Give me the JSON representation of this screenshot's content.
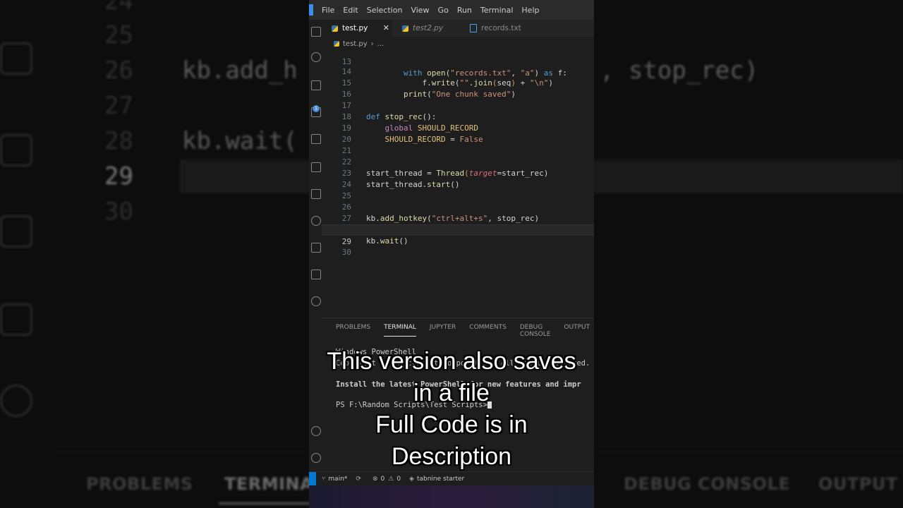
{
  "menu": [
    "File",
    "Edit",
    "Selection",
    "View",
    "Go",
    "Run",
    "Terminal",
    "Help"
  ],
  "tabs": [
    {
      "label": "test.py",
      "active": true,
      "icon": "python-icon"
    },
    {
      "label": "test2.py",
      "active": false,
      "icon": "python-icon"
    },
    {
      "label": "records.txt",
      "active": false,
      "icon": "text-file-icon"
    }
  ],
  "breadcrumb": {
    "file": "test.py",
    "rest": "..."
  },
  "activity_badge": "3",
  "editor": {
    "lines": [
      {
        "n": "13",
        "code": "        with open(\"records.txt\", \"a\") as f:"
      },
      {
        "n": "14",
        "code": "            f.write(\"\".join(seq) + \"\\n\")"
      },
      {
        "n": "15",
        "code": "        print(\"One chunk saved\")"
      },
      {
        "n": "16",
        "code": ""
      },
      {
        "n": "17",
        "code": "def stop_rec():"
      },
      {
        "n": "18",
        "code": "    global SHOULD_RECORD"
      },
      {
        "n": "19",
        "code": "    SHOULD_RECORD = False"
      },
      {
        "n": "20",
        "code": ""
      },
      {
        "n": "21",
        "code": ""
      },
      {
        "n": "22",
        "code": "start_thread = Thread(target=start_rec)"
      },
      {
        "n": "23",
        "code": "start_thread.start()"
      },
      {
        "n": "24",
        "code": ""
      },
      {
        "n": "25",
        "code": ""
      },
      {
        "n": "26",
        "code": "kb.add_hotkey(\"ctrl+alt+s\", stop_rec)"
      },
      {
        "n": "27",
        "code": ""
      },
      {
        "n": "28",
        "code": "kb.wait()"
      },
      {
        "n": "29",
        "code": ""
      },
      {
        "n": "30",
        "code": ""
      }
    ],
    "current_line": "29"
  },
  "panel_tabs": [
    "PROBLEMS",
    "TERMINAL",
    "JUPYTER",
    "COMMENTS",
    "DEBUG CONSOLE",
    "OUTPUT"
  ],
  "terminal": {
    "line1": "Windows PowerShell",
    "line2": "Copyright (C) Microsoft Corporation. All rights reserved.",
    "line3": "Install the latest PowerShell for new features and impr",
    "prompt": "PS F:\\Random Scripts\\Test Scripts>"
  },
  "status": {
    "branch": "main*",
    "errors": "0",
    "warnings": "0",
    "tabnine": "tabnine starter"
  },
  "captions": [
    "This version also saves",
    "in a file",
    "Full Code is in",
    "Description"
  ],
  "background": {
    "code": [
      "kb.add_h",
      ", stop_rec)",
      "kb.wait("
    ],
    "line_numbers": [
      "24",
      "25",
      "26",
      "27",
      "28",
      "29",
      "30"
    ],
    "panel_tabs": [
      "PROBLEMS",
      "TERMINA",
      "DEBUG CONSOLE",
      "OUTPUT"
    ]
  },
  "colors": {
    "accent": "#0078d4",
    "keyword": "#569cd6",
    "function": "#dcdcaa",
    "string": "#ce9178"
  }
}
